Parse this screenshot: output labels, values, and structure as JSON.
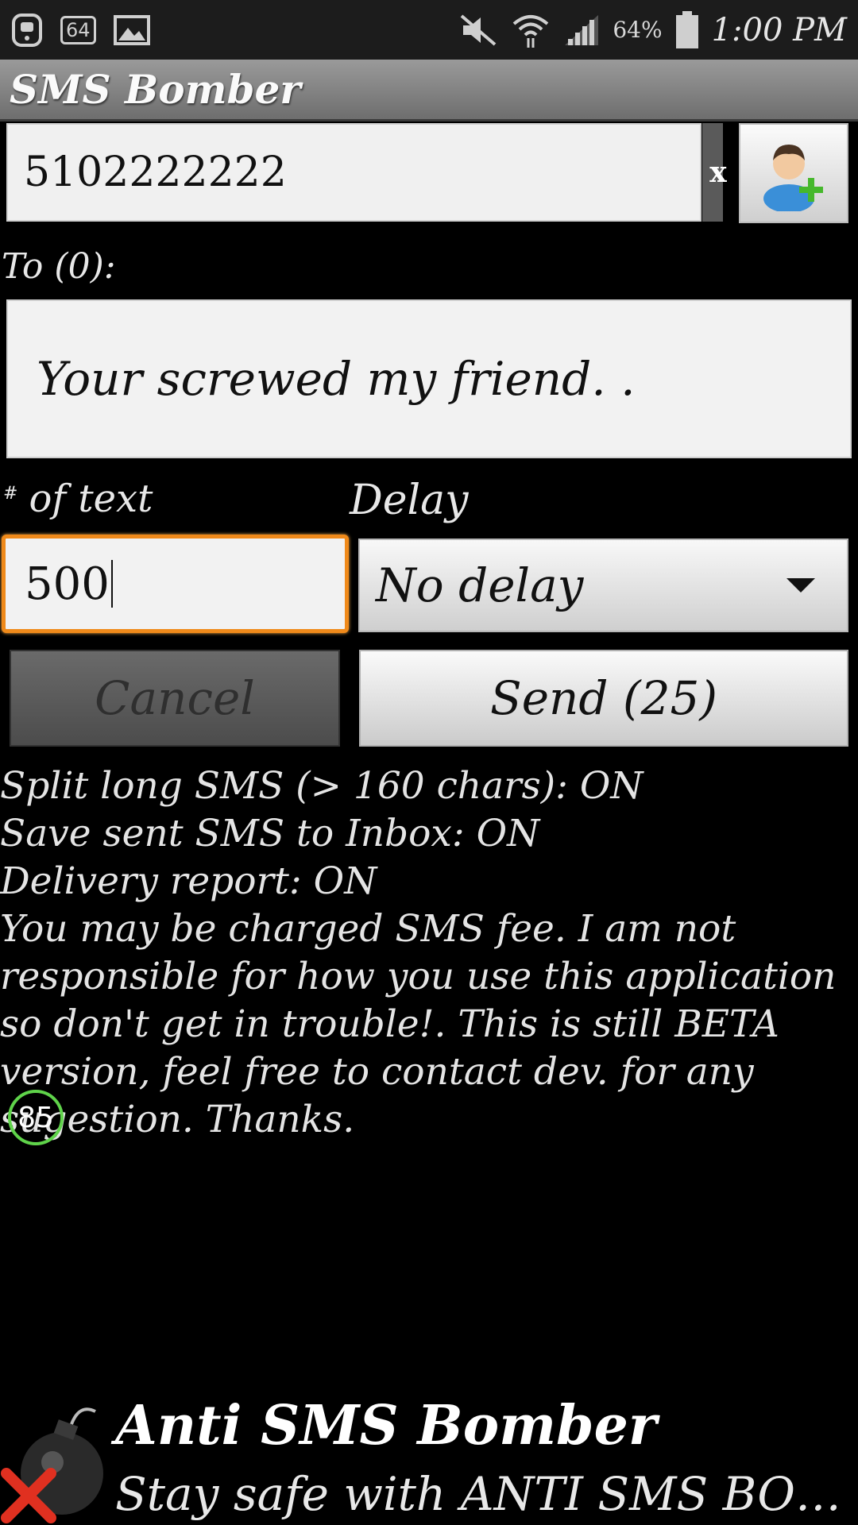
{
  "status_bar": {
    "notif_badge": "64",
    "battery": "64%",
    "time": "1:00 PM"
  },
  "app": {
    "title": "SMS Bomber"
  },
  "phone": {
    "value": "5102222222",
    "clear_label": "x"
  },
  "to_label": "To (0):",
  "message": {
    "value": "Your screwed my friend. ."
  },
  "count": {
    "label_symbol": "#",
    "label": "of text",
    "value": "500"
  },
  "delay": {
    "label": "Delay",
    "value": "No delay"
  },
  "buttons": {
    "cancel": "Cancel",
    "send": "Send (25)"
  },
  "info_lines": [
    "Split long SMS (> 160 chars): ON",
    "Save sent SMS to Inbox: ON",
    "Delivery report: ON",
    "You may be charged SMS fee. I am not responsible for how you use this application so don't get in trouble!. This is still BETA version, feel free to contact dev. for any sugestion. Thanks."
  ],
  "overlay_badge": "85",
  "ad": {
    "title": "Anti SMS Bomber",
    "subtitle": "Stay safe with ANTI SMS BOM..."
  },
  "colors": {
    "focus": "#f08a1a",
    "titlebar": "#8a8a8a",
    "badge_ring": "#5fd34a"
  }
}
